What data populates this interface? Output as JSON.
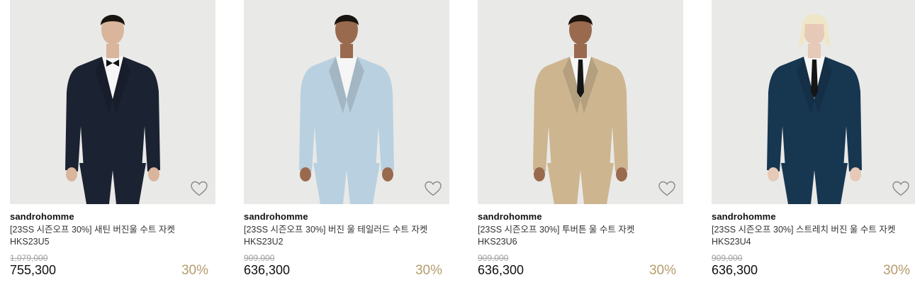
{
  "products": [
    {
      "brand": "sandrohomme",
      "name": "[23SS 시즌오프 30%] 새틴 버진울 수트 자켓 HKS23U5",
      "original_price": "1,079,000",
      "price": "755,300",
      "discount": "30%",
      "suit_color": "#1b2231",
      "tie": "bowtie",
      "wishlist_icon": "heart-outline-icon"
    },
    {
      "brand": "sandrohomme",
      "name": "[23SS 시즌오프 30%] 버진 울 테일러드 수트 자켓 HKS23U2",
      "original_price": "909,000",
      "price": "636,300",
      "discount": "30%",
      "suit_color": "#b9d0e0",
      "tie": "none",
      "wishlist_icon": "heart-outline-icon"
    },
    {
      "brand": "sandrohomme",
      "name": "[23SS 시즌오프 30%] 투버튼 울 수트 자켓 HKS23U6",
      "original_price": "909,000",
      "price": "636,300",
      "discount": "30%",
      "suit_color": "#cdb590",
      "tie": "tie",
      "wishlist_icon": "heart-outline-icon"
    },
    {
      "brand": "sandrohomme",
      "name": "[23SS 시즌오프 30%] 스트레치 버진 울 수트 자켓 HKS23U4",
      "original_price": "909,000",
      "price": "636,300",
      "discount": "30%",
      "suit_color": "#173650",
      "tie": "tie",
      "wishlist_icon": "heart-outline-icon"
    }
  ],
  "colors": {
    "discount": "#b59c6c",
    "original_price": "#a0a0a0",
    "photo_background": "#e9e9e7"
  }
}
